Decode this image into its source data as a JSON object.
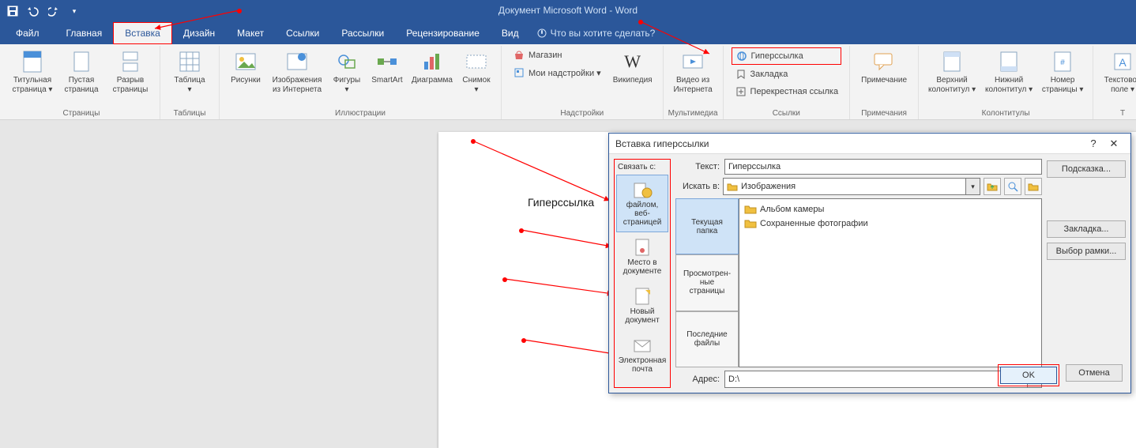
{
  "app": {
    "title": "Документ Microsoft Word - Word"
  },
  "tabs": {
    "file": "Файл",
    "home": "Главная",
    "insert": "Вставка",
    "design": "Дизайн",
    "layout": "Макет",
    "references": "Ссылки",
    "mailings": "Рассылки",
    "review": "Рецензирование",
    "view": "Вид",
    "tell": "Что вы хотите сделать?"
  },
  "ribbon": {
    "pages": {
      "label": "Страницы",
      "cover": "Титульная\nстраница ▾",
      "blank": "Пустая\nстраница",
      "break": "Разрыв\nстраницы"
    },
    "tables": {
      "label": "Таблицы",
      "table": "Таблица\n▾"
    },
    "illustrations": {
      "label": "Иллюстрации",
      "pictures": "Рисунки",
      "online": "Изображения\nиз Интернета",
      "shapes": "Фигуры\n▾",
      "smartart": "SmartArt",
      "chart": "Диаграмма",
      "screenshot": "Снимок\n▾"
    },
    "addins": {
      "label": "Надстройки",
      "store": "Магазин",
      "myaddins": "Мои надстройки  ▾",
      "wikipedia": "Википедия"
    },
    "media": {
      "label": "Мультимедиа",
      "video": "Видео из\nИнтернета"
    },
    "links": {
      "label": "Ссылки",
      "hyperlink": "Гиперссылка",
      "bookmark": "Закладка",
      "crossref": "Перекрестная ссылка"
    },
    "comments": {
      "label": "Примечания",
      "comment": "Примечание"
    },
    "headerfooter": {
      "label": "Колонтитулы",
      "header": "Верхний\nколонтитул ▾",
      "footer": "Нижний\nколонтитул ▾",
      "pagenum": "Номер\nстраницы ▾"
    },
    "text": {
      "label": "Т",
      "textbox": "Текстовое\nполе ▾"
    }
  },
  "document": {
    "hyperlink_text": "Гиперссылка"
  },
  "dialog": {
    "title": "Вставка гиперссылки",
    "link_to_label": "Связать с:",
    "opts": {
      "file_web": "файлом, веб-\nстраницей",
      "place_doc": "Место в\nдокументе",
      "new_doc": "Новый\nдокумент",
      "email": "Электронная\nпочта"
    },
    "text_label": "Текст:",
    "text_value": "Гиперссылка",
    "lookin_label": "Искать в:",
    "lookin_value": "Изображения",
    "nav": {
      "current": "Текущая\nпапка",
      "browsed": "Просмотрен-\nные\nстраницы",
      "recent": "Последние\nфайлы"
    },
    "files": {
      "f1": "Альбом камеры",
      "f2": "Сохраненные фотографии"
    },
    "address_label": "Адрес:",
    "address_value": "D:\\",
    "buttons": {
      "tooltip": "Подсказка...",
      "bookmark": "Закладка...",
      "frame": "Выбор рамки...",
      "ok": "OK",
      "cancel": "Отмена"
    },
    "help": "?",
    "close": "✕"
  }
}
